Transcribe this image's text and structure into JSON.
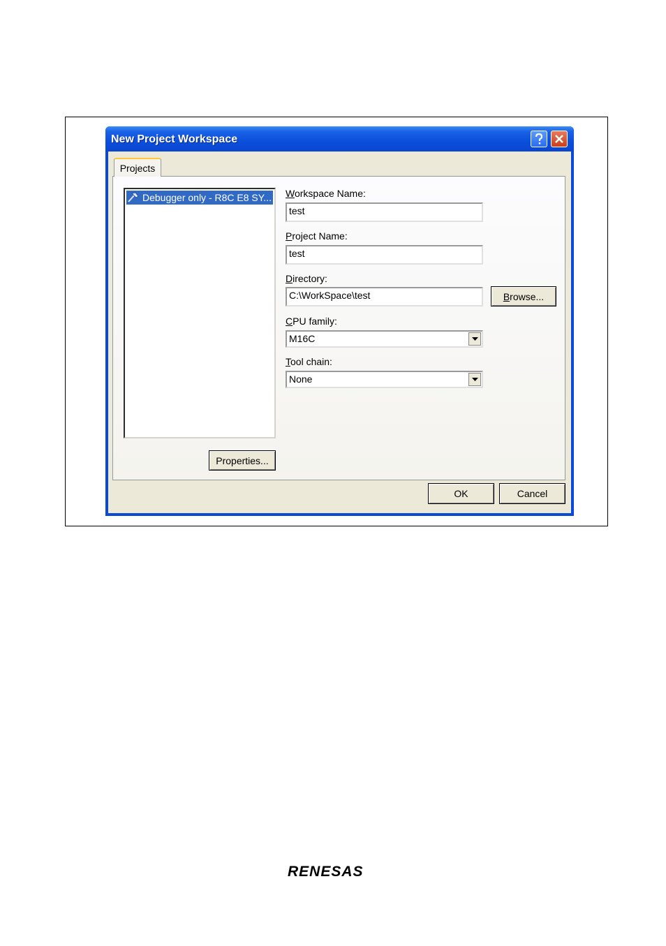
{
  "window": {
    "title": "New Project Workspace"
  },
  "tabs": [
    {
      "label": "Projects"
    }
  ],
  "project_list": {
    "items": [
      {
        "label": "Debugger only - R8C E8 SY..."
      }
    ]
  },
  "form": {
    "workspace_name": {
      "label_accel": "W",
      "label_rest": "orkspace Name:",
      "value": "test"
    },
    "project_name": {
      "label_accel": "P",
      "label_rest": "roject Name:",
      "value": "test"
    },
    "directory": {
      "label_accel": "D",
      "label_rest": "irectory:",
      "value": "C:\\WorkSpace\\test"
    },
    "browse_button": {
      "accel": "B",
      "rest": "rowse..."
    },
    "cpu_family": {
      "label_accel": "C",
      "label_rest": "PU family:",
      "value": "M16C"
    },
    "tool_chain": {
      "label_accel": "T",
      "label_rest": "ool chain:",
      "value": "None"
    }
  },
  "buttons": {
    "properties": "Properties...",
    "ok": "OK",
    "cancel": "Cancel"
  },
  "footer": {
    "logo_text": "RENESAS"
  },
  "icons": {
    "help": "help-icon",
    "close": "close-icon",
    "project": "hammer-icon",
    "dropdown": "chevron-down-icon"
  },
  "colors": {
    "titlebar": "#0a48d8",
    "dialog_bg": "#ece9d8",
    "selection": "#316ac5",
    "close_button": "#c8401c"
  }
}
